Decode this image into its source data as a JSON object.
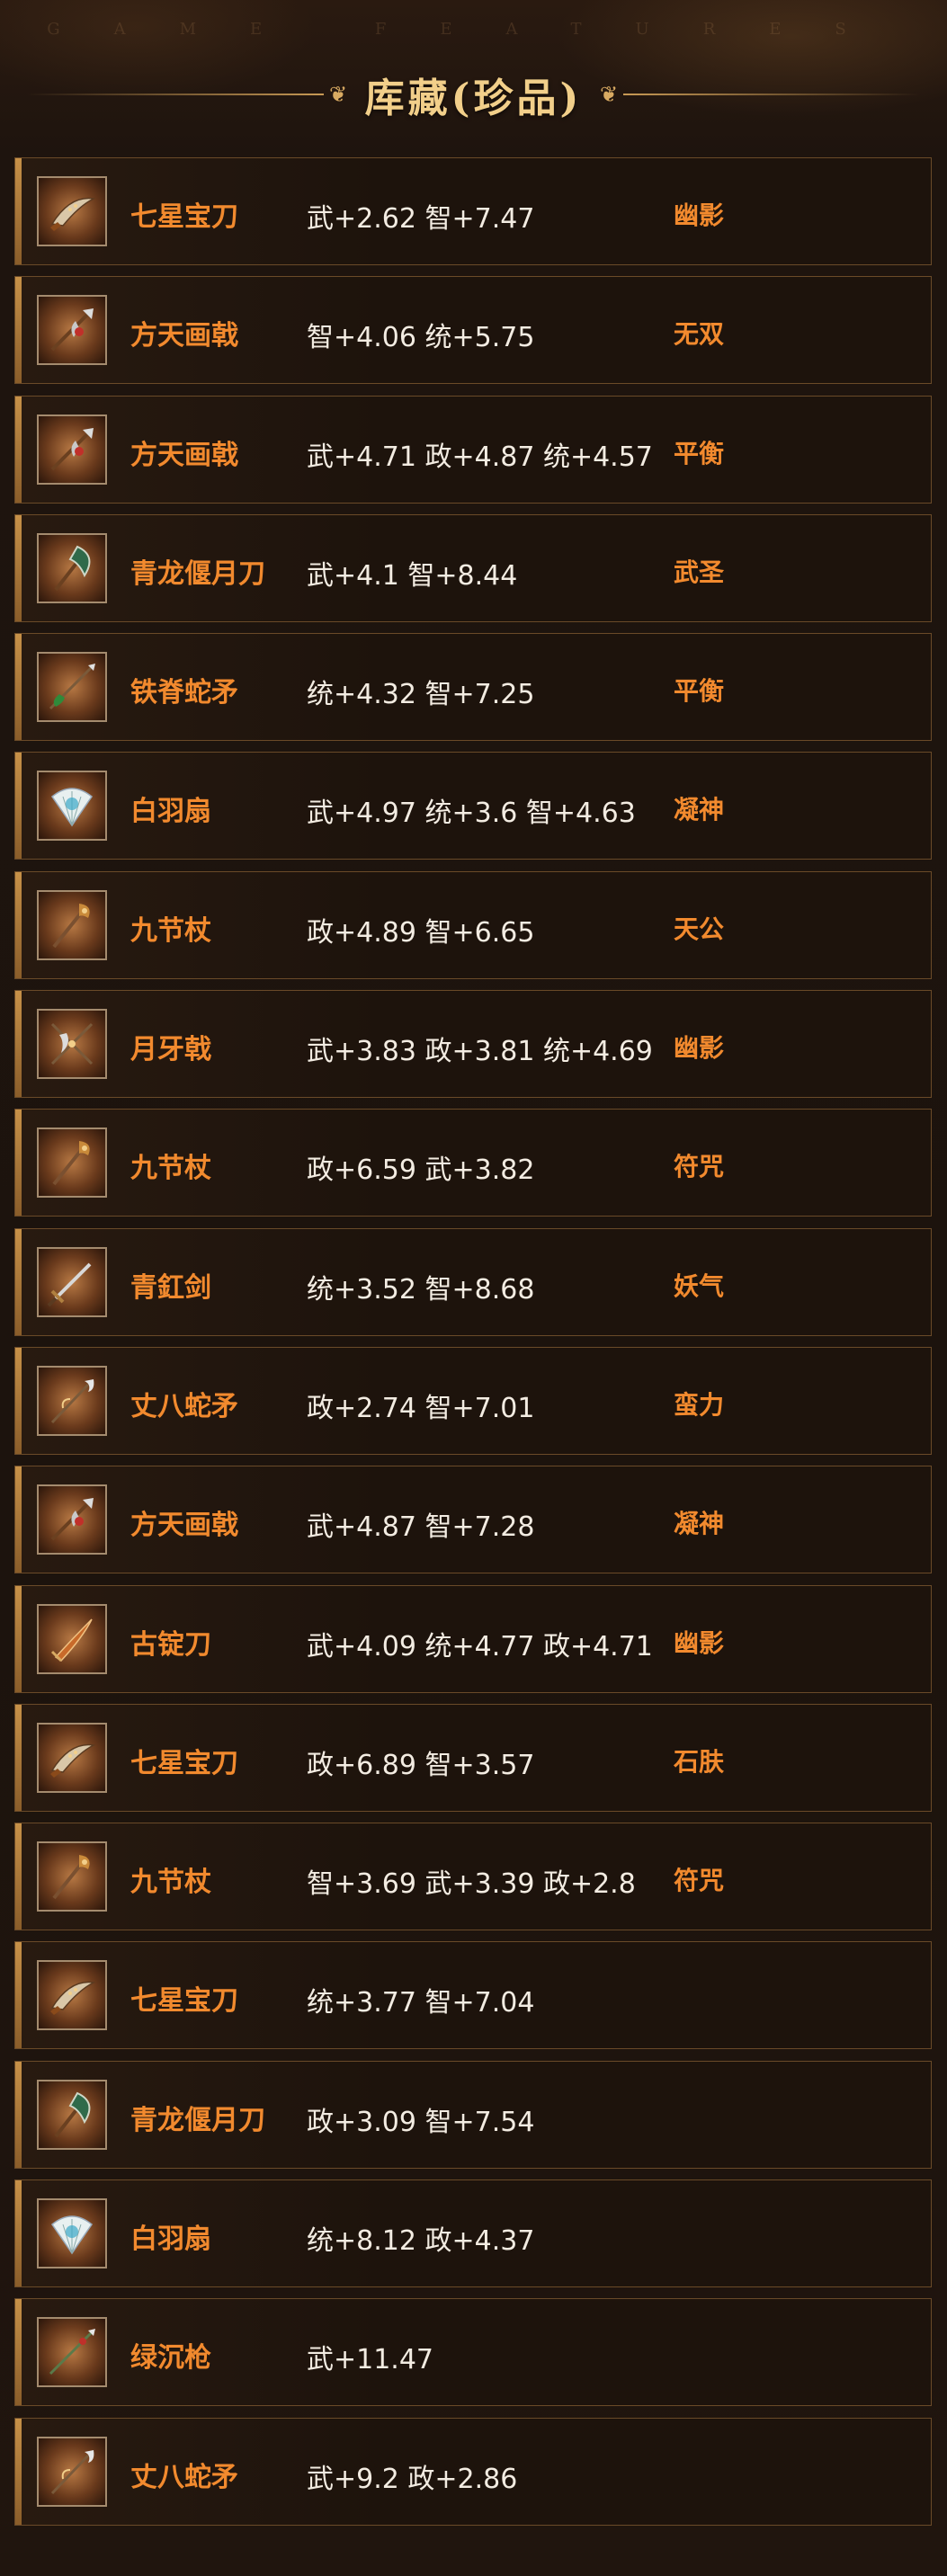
{
  "header": {
    "watermark": "GAME FEATURES",
    "title": "库藏(珍品)"
  },
  "items": [
    {
      "name": "七星宝刀",
      "stats": "武+2.62 智+7.47",
      "trait": "幽影",
      "icon": "blade-icon"
    },
    {
      "name": "方天画戟",
      "stats": "智+4.06 统+5.75",
      "trait": "无双",
      "icon": "halberd-icon"
    },
    {
      "name": "方天画戟",
      "stats": "武+4.71 政+4.87 统+4.57",
      "trait": "平衡",
      "icon": "halberd-icon"
    },
    {
      "name": "青龙偃月刀",
      "stats": "武+4.1 智+8.44",
      "trait": "武圣",
      "icon": "glaive-icon"
    },
    {
      "name": "铁脊蛇矛",
      "stats": "统+4.32 智+7.25",
      "trait": "平衡",
      "icon": "spear-icon"
    },
    {
      "name": "白羽扇",
      "stats": "武+4.97 统+3.6 智+4.63",
      "trait": "凝神",
      "icon": "fan-icon"
    },
    {
      "name": "九节杖",
      "stats": "政+4.89 智+6.65",
      "trait": "天公",
      "icon": "staff-icon"
    },
    {
      "name": "月牙戟",
      "stats": "武+3.83 政+3.81 统+4.69",
      "trait": "幽影",
      "icon": "crescent-halberd-icon"
    },
    {
      "name": "九节杖",
      "stats": "政+6.59 武+3.82",
      "trait": "符咒",
      "icon": "staff-icon"
    },
    {
      "name": "青釭剑",
      "stats": "统+3.52 智+8.68",
      "trait": "妖气",
      "icon": "sword-icon"
    },
    {
      "name": "丈八蛇矛",
      "stats": "政+2.74 智+7.01",
      "trait": "蛮力",
      "icon": "serpent-spear-icon"
    },
    {
      "name": "方天画戟",
      "stats": "武+4.87 智+7.28",
      "trait": "凝神",
      "icon": "halberd-icon"
    },
    {
      "name": "古锭刀",
      "stats": "武+4.09 统+4.77 政+4.71",
      "trait": "幽影",
      "icon": "sabre-icon"
    },
    {
      "name": "七星宝刀",
      "stats": "政+6.89 智+3.57",
      "trait": "石肤",
      "icon": "blade-icon"
    },
    {
      "name": "九节杖",
      "stats": "智+3.69 武+3.39 政+2.8",
      "trait": "符咒",
      "icon": "staff-icon"
    },
    {
      "name": "七星宝刀",
      "stats": "统+3.77 智+7.04",
      "trait": "",
      "icon": "blade-icon"
    },
    {
      "name": "青龙偃月刀",
      "stats": "政+3.09 智+7.54",
      "trait": "",
      "icon": "glaive-icon"
    },
    {
      "name": "白羽扇",
      "stats": "统+8.12 政+4.37",
      "trait": "",
      "icon": "fan-icon"
    },
    {
      "name": "绿沉枪",
      "stats": "武+11.47",
      "trait": "",
      "icon": "lance-icon"
    },
    {
      "name": "丈八蛇矛",
      "stats": "武+9.2 政+2.86",
      "trait": "",
      "icon": "serpent-spear-icon"
    }
  ],
  "colors": {
    "accent": "#f28a2e",
    "title": "#f2cf8a",
    "text": "#f3ece2",
    "border": "#6a4a28"
  }
}
